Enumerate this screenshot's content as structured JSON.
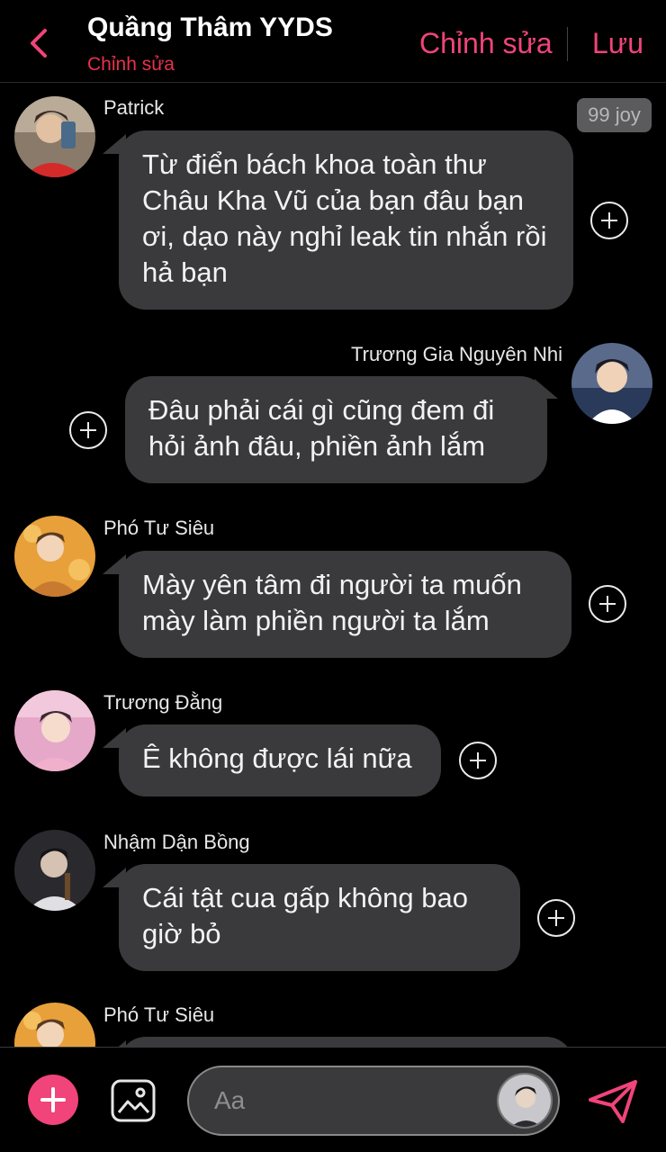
{
  "header": {
    "title": "Quầng Thâm YYDS",
    "subtitle": "Chỉnh sửa",
    "edit_label": "Chỉnh sửa",
    "save_label": "Lưu"
  },
  "badge": "99 joy",
  "messages": [
    {
      "sender": "Patrick",
      "text": "Từ điển bách khoa toàn thư Châu Kha Vũ của bạn đâu bạn ơi, dạo này nghỉ leak tin nhắn rồi hả bạn"
    },
    {
      "sender": "Trương Gia Nguyên Nhi",
      "text": "Đâu phải cái gì cũng đem đi hỏi ảnh đâu, phiền ảnh lắm"
    },
    {
      "sender": "Phó Tư Siêu",
      "text": "Mày yên tâm đi người ta muốn mày làm phiền người ta lắm"
    },
    {
      "sender": "Trương Đằng",
      "text": "Ê không được lái nữa"
    },
    {
      "sender": "Nhậm Dận Bồng",
      "text": "Cái tật cua gấp không bao giờ bỏ"
    },
    {
      "sender": "Phó Tư Siêu",
      "text": ""
    }
  ],
  "composer": {
    "placeholder": "Aa"
  },
  "colors": {
    "accent": "#f0447a",
    "subtitle": "#e8324a",
    "bubble": "#3a3a3c",
    "background": "#000000"
  },
  "icons": [
    "back-chevron-icon",
    "add-reaction-icon",
    "plus-icon",
    "image-icon",
    "send-icon"
  ]
}
